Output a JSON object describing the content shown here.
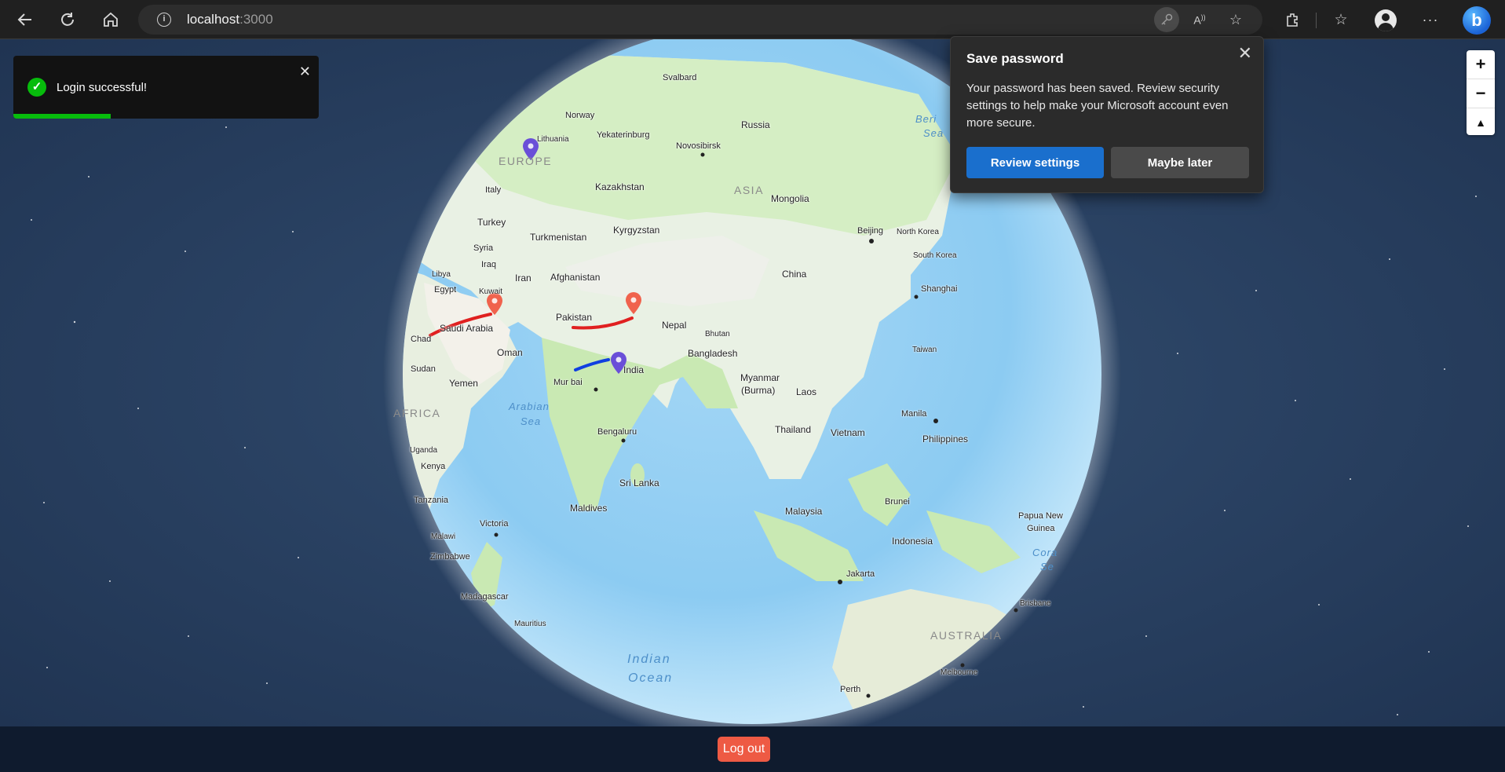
{
  "browser": {
    "url_host": "localhost",
    "url_port": ":3000"
  },
  "toast": {
    "message": "Login successful!",
    "progress": 0.32
  },
  "popup": {
    "title": "Save password",
    "body": "Your password has been saved. Review security settings to help make your Microsoft account even more secure.",
    "primary_button": "Review settings",
    "secondary_button": "Maybe later"
  },
  "map": {
    "regions": {
      "europe": "EUROPE",
      "asia": "ASIA",
      "africa": "AFRICA",
      "australia": "AUSTRALIA"
    },
    "seas": {
      "arabian_1": "Arabian",
      "arabian_2": "Sea",
      "indian_1": "Indian",
      "indian_2": "Ocean",
      "bering_1": "Beri",
      "bering_2": "Sea",
      "coral_1": "Cora",
      "coral_2": "Se"
    },
    "labels": {
      "svalbard": "Svalbard",
      "norway": "Norway",
      "lithuania": "Lithuania",
      "yekaterinburg": "Yekaterinburg",
      "russia": "Russia",
      "novosibirsk": "Novosibirsk",
      "kazakhstan": "Kazakhstan",
      "mongolia": "Mongolia",
      "italy": "Italy",
      "turkey": "Turkey",
      "turkmenistan": "Turkmenistan",
      "kyrgyzstan": "Kyrgyzstan",
      "beijing": "Beijing",
      "north_korea": "North Korea",
      "south_korea": "South Korea",
      "syria": "Syria",
      "iraq": "Iraq",
      "libya": "Libya",
      "iran": "Iran",
      "afghanistan": "Afghanistan",
      "china": "China",
      "egypt": "Egypt",
      "kuwait": "Kuwait",
      "shanghai": "Shanghai",
      "pakistan": "Pakistan",
      "saudi_arabia": "Saudi Arabia",
      "nepal": "Nepal",
      "bhutan": "Bhutan",
      "chad": "Chad",
      "oman": "Oman",
      "bangladesh": "Bangladesh",
      "taiwan": "Taiwan",
      "sudan": "Sudan",
      "india": "India",
      "myanmar": "Myanmar",
      "burma": "(Burma)",
      "yemen": "Yemen",
      "mumbai": "Mur bai",
      "laos": "Laos",
      "manila": "Manila",
      "thailand": "Thailand",
      "vietnam": "Vietnam",
      "philippines": "Philippines",
      "bengaluru": "Bengaluru",
      "uganda": "Uganda",
      "kenya": "Kenya",
      "sri_lanka": "Sri Lanka",
      "tanzania": "Tanzania",
      "maldives": "Maldives",
      "brunei": "Brunei",
      "malaysia": "Malaysia",
      "papua_1": "Papua New",
      "papua_2": "Guinea",
      "malawi": "Malawi",
      "victoria": "Victoria",
      "indonesia": "Indonesia",
      "zimbabwe": "Zimbabwe",
      "jakarta": "Jakarta",
      "brisbane": "Brisbane",
      "madagascar": "Madagascar",
      "mauritius": "Mauritius",
      "melbourne": "Melbourne",
      "perth": "Perth"
    },
    "zoom_in": "+",
    "zoom_out": "−",
    "compass": "▲"
  },
  "footer": {
    "logout_label": "Log out"
  },
  "colors": {
    "route_red": "#e02020",
    "route_blue": "#1040e0",
    "pin_purple": "#6a4fd8",
    "pin_orange": "#f0624d"
  }
}
